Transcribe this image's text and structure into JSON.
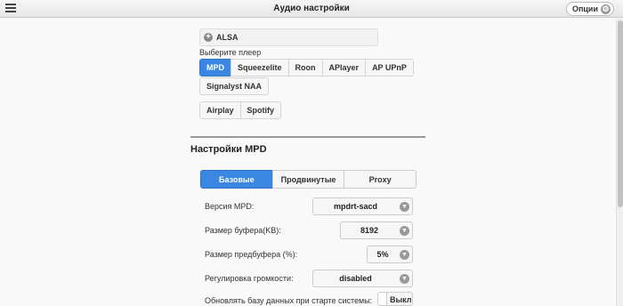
{
  "header": {
    "title": "Аудио настройки",
    "options_label": "Опции"
  },
  "output": {
    "alsa_label": "ALSA"
  },
  "player": {
    "choose_label": "Выберите плеер",
    "row1": [
      "MPD",
      "Squeezelite",
      "Roon",
      "APlayer",
      "AP UPnP"
    ],
    "row2": [
      "Signalyst NAA"
    ],
    "row3": [
      "Airplay",
      "Spotify"
    ],
    "active": "MPD"
  },
  "mpd": {
    "section_title": "Настройки MPD",
    "tabs": [
      "Базовые",
      "Продвинутые",
      "Proxy"
    ],
    "active_tab": "Базовые",
    "fields": {
      "version": {
        "label": "Версия MPD:",
        "value": "mpdrt-sacd"
      },
      "buffer": {
        "label": "Размер буфера(KB):",
        "value": "8192"
      },
      "prebuffer": {
        "label": "Размер предбуфера (%):",
        "value": "5%"
      },
      "volume": {
        "label": "Регулировка громкости:",
        "value": "disabled"
      },
      "update_db": {
        "label": "Обновлять базу данных при старте системы:",
        "value": "Выкл"
      }
    }
  },
  "colors": {
    "accent": "#3a87e3",
    "background": "#f9f9f9"
  },
  "icons": {
    "menu": "hamburger-icon",
    "options": "gear-icon",
    "alsa": "plus-circle-icon",
    "select": "chevron-down-icon"
  }
}
